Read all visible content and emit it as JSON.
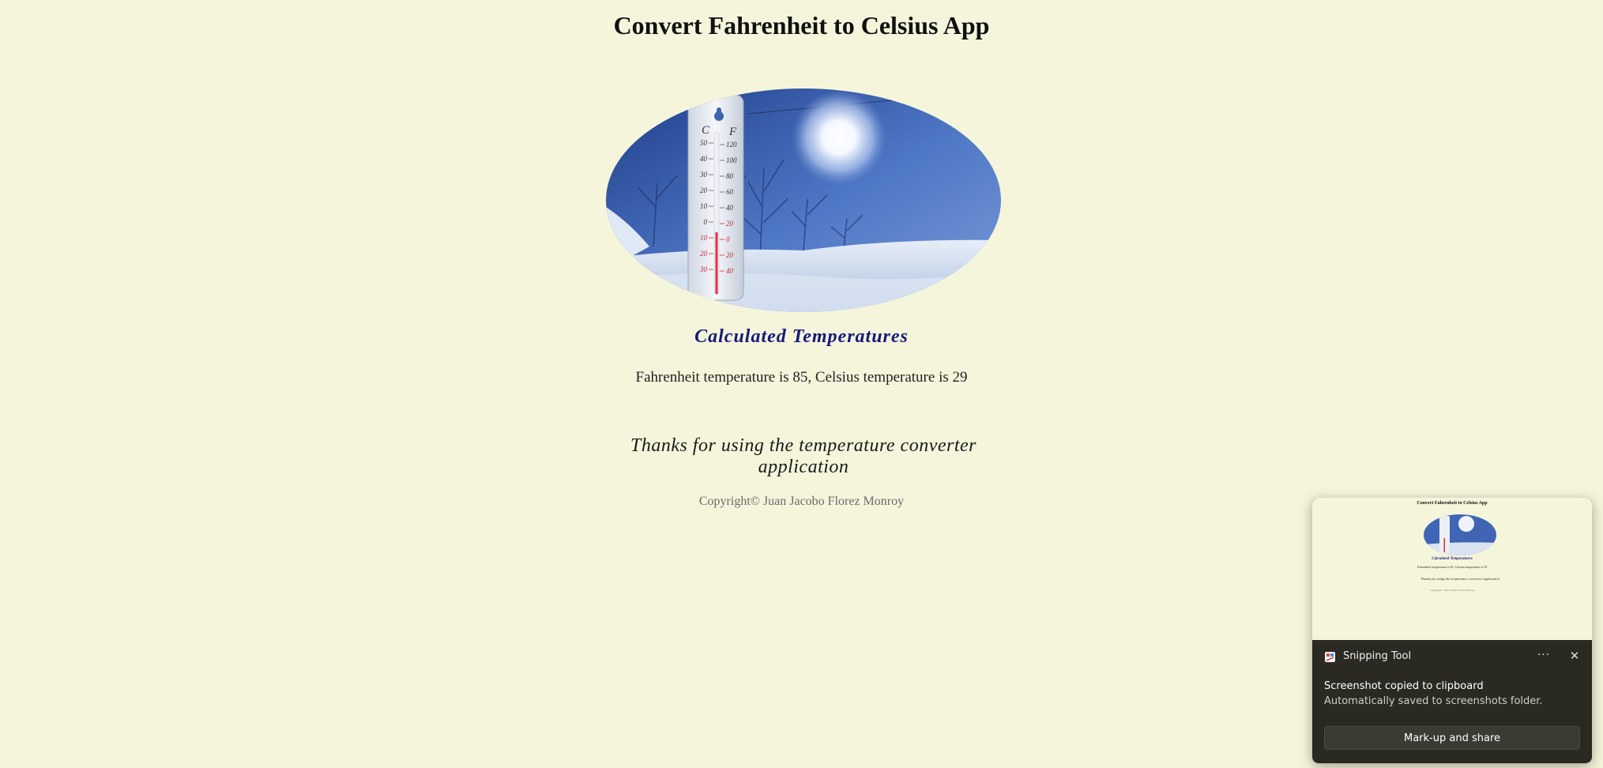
{
  "page": {
    "title": "Convert Fahrenheit to Celsius App",
    "subtitle": "Calculated Temperatures",
    "result": "Fahrenheit temperature is 85, Celsius temperature is 29",
    "thanks": "Thanks for using the temperature converter application",
    "copyright": "Copyright© Juan Jacobo Florez Monroy"
  },
  "thermometer": {
    "celsius_label": "C",
    "fahrenheit_label": "F",
    "celsius_ticks": [
      "50",
      "40",
      "30",
      "20",
      "10",
      "0",
      "10",
      "20",
      "30"
    ],
    "fahrenheit_ticks": [
      "120",
      "100",
      "80",
      "60",
      "40",
      "20",
      "0",
      "20",
      "40"
    ]
  },
  "toast": {
    "app_name": "Snipping Tool",
    "more_label": "···",
    "close_label": "✕",
    "heading": "Screenshot copied to clipboard",
    "text": "Automatically saved to screenshots folder.",
    "button_label": "Mark-up and share"
  },
  "colors": {
    "background": "#f5f5dc",
    "subtitle": "#16197a",
    "toast_background": "#2a2a22"
  }
}
